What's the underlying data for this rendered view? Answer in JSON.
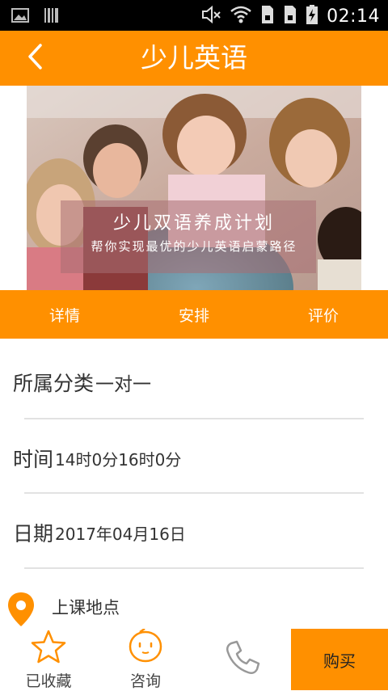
{
  "status_bar": {
    "time": "02:14",
    "icons": [
      "image-icon",
      "barcode-icon",
      "mute-icon",
      "wifi-icon",
      "sim-icon",
      "sim-icon",
      "battery-charging-icon"
    ]
  },
  "app_bar": {
    "title": "少儿英语",
    "back_icon": "chevron-left-icon"
  },
  "banner": {
    "headline": "少儿双语养成计划",
    "subline": "帮你实现最优的少儿英语启蒙路径"
  },
  "tabs": [
    {
      "label": "详情"
    },
    {
      "label": "安排"
    },
    {
      "label": "评价"
    }
  ],
  "details": {
    "category": {
      "label": "所属分类",
      "value": "一对一"
    },
    "time": {
      "label": "时间",
      "value": "14时0分16时0分"
    },
    "date": {
      "label": "日期",
      "value": "2017年04月16日"
    }
  },
  "location": {
    "label": "上课地点",
    "icon": "map-pin-icon"
  },
  "bottom_bar": {
    "favorite_label": "已收藏",
    "consult_label": "咨询",
    "phone_icon": "phone-icon",
    "buy_label": "购买"
  },
  "colors": {
    "accent": "#ff9000",
    "text": "#333333",
    "divider": "#e2e2e2"
  }
}
